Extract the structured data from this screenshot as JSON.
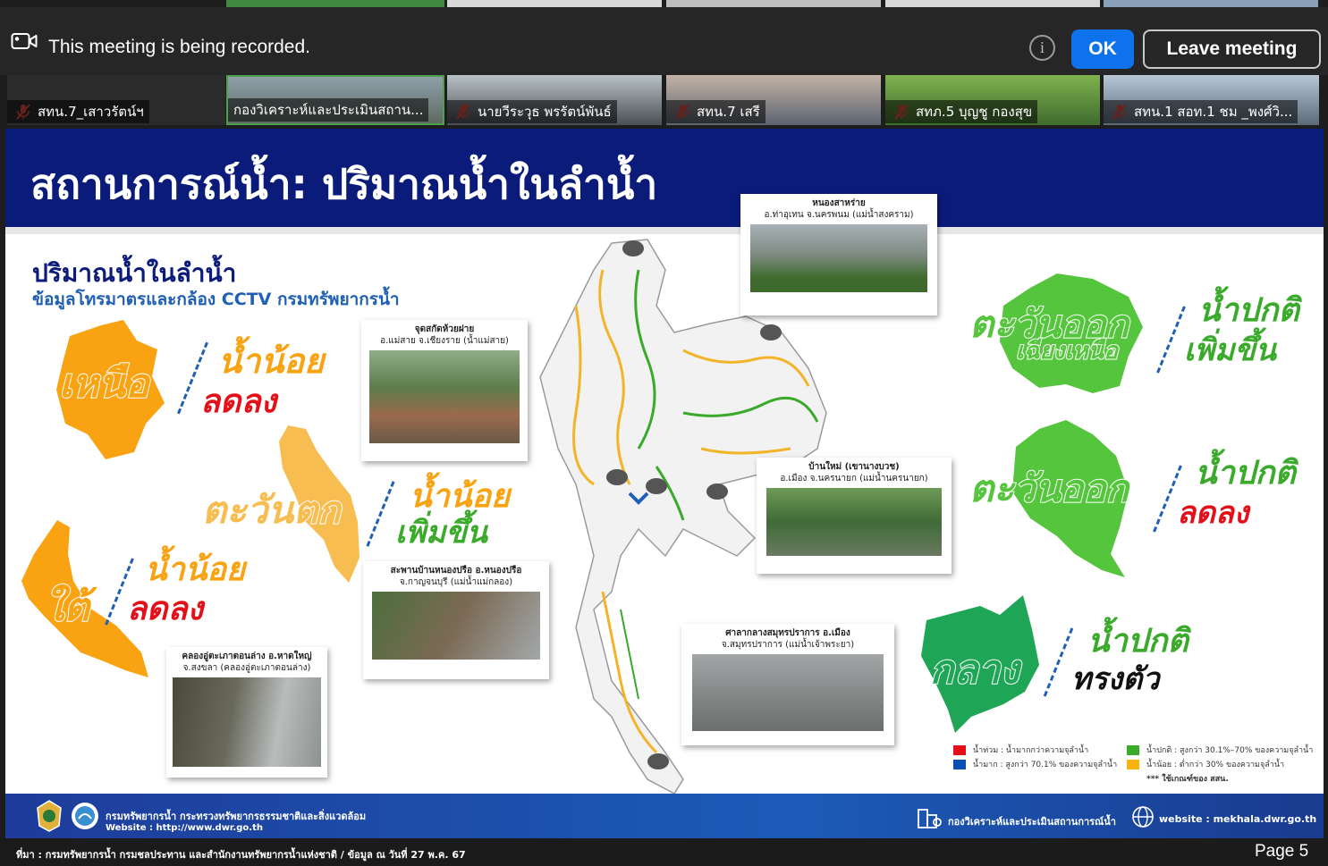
{
  "recording_bar": {
    "message": "This meeting is being recorded.",
    "info_symbol": "i",
    "ok_label": "OK",
    "leave_label": "Leave meeting"
  },
  "participants": [
    {
      "name": "สทน.7_เสาวรัตน์ฯ",
      "muted": true
    },
    {
      "name": "กองวิเคราะห์และประเมินสถาน...",
      "muted": false
    },
    {
      "name": "นายวีระวุธ พรรัตน์พันธ์",
      "muted": true
    },
    {
      "name": "สทน.7 เสรี",
      "muted": true
    },
    {
      "name": "สทภ.5 บุญชู กองสุข",
      "muted": true
    },
    {
      "name": "สทน.1 สอท.1 ชม _พงศ์วิ...",
      "muted": true
    }
  ],
  "slide": {
    "title": "สถานการณ์น้ำ: ปริมาณน้ำในลำน้ำ",
    "subtitle": "ปริมาณน้ำในลำน้ำ",
    "subtitle2": "ข้อมูลโทรมาตรและกล้อง CCTV กรมทรัพยากรน้ำ",
    "regions": {
      "north": {
        "name": "เหนือ",
        "l1": "น้ำน้อย",
        "l2": "ลดลง"
      },
      "west": {
        "name": "ตะวันตก",
        "l1": "น้ำน้อย",
        "l2": "เพิ่มขึ้น"
      },
      "south": {
        "name": "ใต้",
        "l1": "น้ำน้อย",
        "l2": "ลดลง"
      },
      "northeast": {
        "name": "ตะวันออก",
        "name2": "เฉียงเหนือ",
        "l1": "น้ำปกติ",
        "l2": "เพิ่มขึ้น"
      },
      "east": {
        "name": "ตะวันออก",
        "l1": "น้ำปกติ",
        "l2": "ลดลง"
      },
      "central": {
        "name": "กลาง",
        "l1": "น้ำปกติ",
        "l2": "ทรงตัว"
      }
    },
    "photos": {
      "p1": {
        "c1": "หนองสาหร่าย",
        "c2": "อ.ท่าอุเทน จ.นครพนม (แม่น้ำสงคราม)"
      },
      "p2": {
        "c1": "จุดสกัดห้วยฝาย",
        "c2": "อ.แม่สาย จ.เชียงราย (น้ำแม่สาย)"
      },
      "p3": {
        "c1": "บ้านใหม่ (เขานางบวช)",
        "c2": "อ.เมือง จ.นครนายก (แม่น้ำนครนายก)"
      },
      "p4": {
        "c1": "สะพานบ้านหนองปรือ อ.หนองปรือ",
        "c2": "จ.กาญจนบุรี (แม่น้ำแม่กลอง)"
      },
      "p5": {
        "c1": "ศาลากลางสมุทรปราการ อ.เมือง",
        "c2": "จ.สมุทรปราการ (แม่น้ำเจ้าพระยา)"
      },
      "p6": {
        "c1": "คลองอู่ตะเภาตอนล่าง อ.หาดใหญ่",
        "c2": "จ.สงขลา (คลองอู่ตะเภาตอนล่าง)"
      }
    },
    "legend": {
      "l1": "น้ำท่วม : น้ำมากกว่าความจุลำน้ำ",
      "l2": "น้ำมาก : สูงกว่า 70.1% ของความจุลำน้ำ",
      "l3": "น้ำปกติ : สูงกว่า 30.1%–70% ของความจุลำน้ำ",
      "l4": "น้ำน้อย : ต่ำกว่า 30% ของความจุลำน้ำ",
      "l5": "*** ใช้เกณฑ์ของ สสน.",
      "colors": {
        "flood": "#e3101a",
        "high": "#0b4fb4",
        "normal": "#3aaa2b",
        "low": "#f6b312"
      }
    },
    "footer": {
      "org": "กรมทรัพยากรน้ำ กระทรวงทรัพยากรธรรมชาติและสิ่งแวดล้อม",
      "website_left": "Website : http://www.dwr.go.th",
      "division": "กองวิเคราะห์และประเมินสถานการณ์น้ำ",
      "website_right": "website : mekhala.dwr.go.th"
    }
  },
  "bottom": {
    "source": "ที่มา : กรมทรัพยากรน้ำ กรมชลประทาน และสำนักงานทรัพยากรน้ำแห่งชาติ / ข้อมูล ณ วันที่ 27 พ.ค. 67",
    "page": "Page 5"
  }
}
